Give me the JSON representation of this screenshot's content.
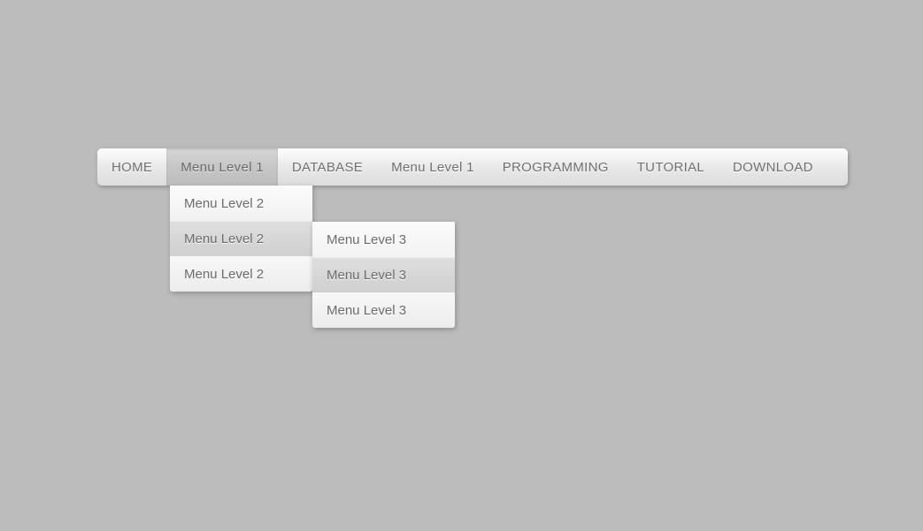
{
  "menu": {
    "items": [
      {
        "label": "HOME"
      },
      {
        "label": "Menu Level 1"
      },
      {
        "label": "DATABASE"
      },
      {
        "label": "Menu Level 1"
      },
      {
        "label": "PROGRAMMING"
      },
      {
        "label": "TUTORIAL"
      },
      {
        "label": "DOWNLOAD"
      }
    ]
  },
  "submenu_level2": {
    "items": [
      {
        "label": "Menu Level 2"
      },
      {
        "label": "Menu Level 2"
      },
      {
        "label": "Menu Level 2"
      }
    ]
  },
  "submenu_level3": {
    "items": [
      {
        "label": "Menu Level 3"
      },
      {
        "label": "Menu Level 3"
      },
      {
        "label": "Menu Level 3"
      }
    ]
  }
}
